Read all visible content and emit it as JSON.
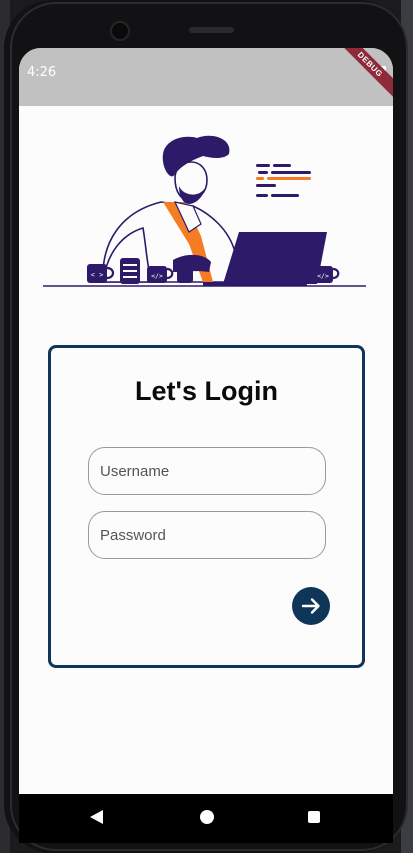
{
  "status_bar": {
    "time": "4:26",
    "debug_label": "DEBUG"
  },
  "login": {
    "title": "Let's Login",
    "username_placeholder": "Username",
    "password_placeholder": "Password"
  },
  "icons": {
    "submit": "arrow-right-icon",
    "back": "nav-back-icon",
    "home": "nav-home-icon",
    "recents": "nav-recents-icon"
  },
  "colors": {
    "accent": "#0f3558",
    "illustration_primary": "#2d1b69",
    "illustration_highlight": "#f57c22",
    "debug_banner": "#8e2a3a"
  }
}
